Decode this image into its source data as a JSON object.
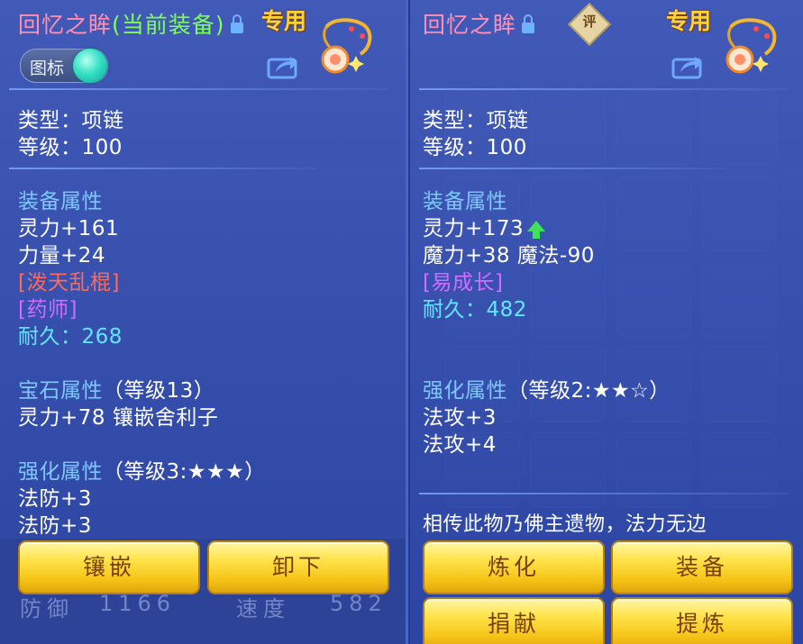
{
  "left": {
    "title": "回忆之眸",
    "current_tag": "(当前装备)",
    "special_label": "专用",
    "toggle_label": "图标",
    "type": "类型：项链",
    "level": "等级：100",
    "attr_header": "装备属性",
    "attrs": [
      "灵力+161",
      "力量+24"
    ],
    "effect_red": "[泼天乱棍]",
    "effect_purple": "[药师]",
    "durability": "耐久：268",
    "gem_header": "宝石属性",
    "gem_level": "（等级13）",
    "gem_line": "灵力+78 镶嵌舍利子",
    "enh_header": "强化属性",
    "enh_level": "（等级3:★★★）",
    "enh_lines": [
      "法防+3",
      "法防+3"
    ],
    "buttons": {
      "inlay": "镶嵌",
      "unload": "卸下"
    },
    "footer": {
      "defense": "防御",
      "defense_val": "1166",
      "speed": "速度",
      "speed_val": "582"
    }
  },
  "right": {
    "title": "回忆之眸",
    "ping_label": "评",
    "special_label": "专用",
    "type": "类型：项链",
    "level": "等级：100",
    "attr_header": "装备属性",
    "attr1": "灵力+173",
    "attr2": "魔力+38 魔法-90",
    "effect_purple": "[易成长]",
    "durability": "耐久：482",
    "enh_header": "强化属性",
    "enh_level": "（等级2:★★☆）",
    "enh_lines": [
      "法攻+3",
      "法攻+4"
    ],
    "desc": "相传此物乃佛主遗物，法力无边",
    "buttons": {
      "refine": "炼化",
      "equip": "装备",
      "donate": "捐献",
      "extract": "提炼"
    }
  },
  "colors": {
    "title_pink": "#ff8fb4",
    "current_green": "#7cff55",
    "header_blue": "#7ec8ff",
    "durability_cyan": "#62e6ff",
    "effect_red": "#ff6a5a",
    "effect_purple": "#d26bff",
    "special_gold": "#ffd23a",
    "button_gold": "#f5c316",
    "up_arrow_green": "#3ee05c"
  },
  "icons": [
    "lock-icon",
    "share-icon",
    "necklace-icon",
    "up-arrow-icon",
    "ping-badge-icon"
  ]
}
